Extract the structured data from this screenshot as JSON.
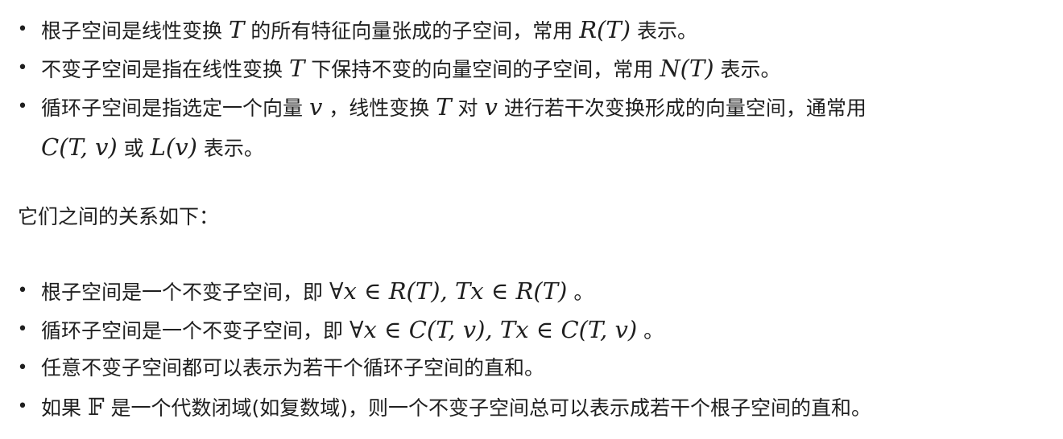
{
  "list1": [
    {
      "t1": "根子空间是线性变换 ",
      "m1": "T",
      "t2": " 的所有特征向量张成的子空间，常用 ",
      "m2": "R(T)",
      "t3": " 表示。"
    },
    {
      "t1": "不变子空间是指在线性变换 ",
      "m1": "T",
      "t2": " 下保持不变的向量空间的子空间，常用 ",
      "m2": "N(T)",
      "t3": " 表示。"
    },
    {
      "t1": "循环子空间是指选定一个向量 ",
      "m1": "v",
      "t2": " ，线性变换 ",
      "m2": "T",
      "t3": " 对 ",
      "m3": "v",
      "t4": " 进行若干次变换形成的向量空间，通常用",
      "m4": "C(T, v)",
      "t5": " 或 ",
      "m5": "L(v)",
      "t6": " 表示。"
    }
  ],
  "intro": "它们之间的关系如下：",
  "list2": [
    {
      "t1": "根子空间是一个不变子空间，即 ",
      "m1": "∀x ∈ R(T), Tx ∈ R(T)",
      "t2": " 。"
    },
    {
      "t1": "循环子空间是一个不变子空间，即 ",
      "m1": "∀x ∈ C(T, v), Tx ∈ C(T, v)",
      "t2": " 。"
    },
    {
      "t1": "任意不变子空间都可以表示为若干个循环子空间的直和。"
    },
    {
      "t1": "如果 ",
      "m1": "𝔽",
      "t2": " 是一个代数闭域(如复数域)，则一个不变子空间总可以表示成若干个根子空间的直和。"
    }
  ],
  "bullet": "•"
}
